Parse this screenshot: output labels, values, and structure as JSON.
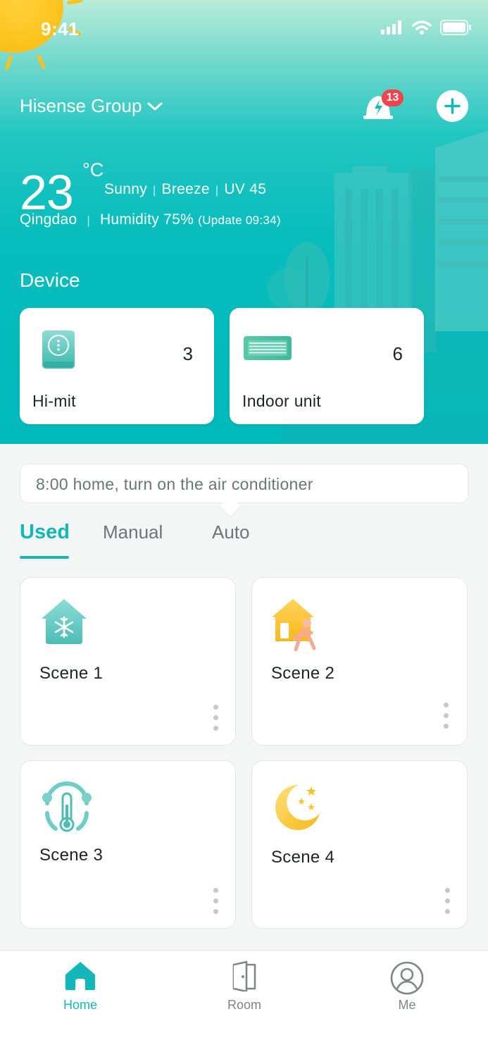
{
  "status_bar": {
    "time": "9:41"
  },
  "header": {
    "group_name": "Hisense Group",
    "notification_count": "13"
  },
  "weather": {
    "temperature": "23",
    "unit": "°C",
    "condition": "Sunny",
    "wind": "Breeze",
    "uv": "UV 45",
    "city": "Qingdao",
    "humidity": "Humidity 75%",
    "update": "(Update 09:34)"
  },
  "device_section": {
    "title": "Device",
    "cards": [
      {
        "name": "Hi-mit",
        "count": "3",
        "icon": "hi-mit-panel-icon"
      },
      {
        "name": "Indoor unit",
        "count": "6",
        "icon": "indoor-unit-icon"
      }
    ]
  },
  "tip": {
    "text": "8:00 home, turn on the air conditioner"
  },
  "scene_tabs": {
    "items": [
      "Used",
      "Manual",
      "Auto"
    ],
    "active": "Used"
  },
  "scenes": [
    {
      "name": "Scene 1",
      "icon": "snowflake-house-icon"
    },
    {
      "name": "Scene 2",
      "icon": "person-leaving-house-icon"
    },
    {
      "name": "Scene 3",
      "icon": "thermometer-icon"
    },
    {
      "name": "Scene 4",
      "icon": "moon-stars-icon"
    }
  ],
  "tabbar": {
    "items": [
      {
        "label": "Home",
        "icon": "home-icon",
        "active": true
      },
      {
        "label": "Room",
        "icon": "door-icon",
        "active": false
      },
      {
        "label": "Me",
        "icon": "profile-icon",
        "active": false
      }
    ]
  },
  "colors": {
    "accent": "#13b7b9",
    "hero": "#00b9ba",
    "badge": "#f2434b",
    "sun": "#fcc21c"
  }
}
